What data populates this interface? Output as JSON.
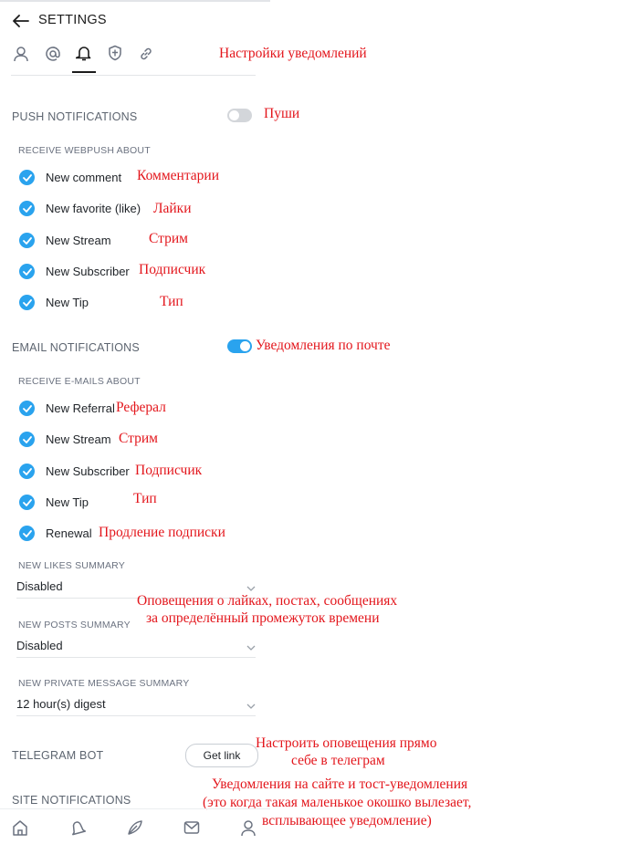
{
  "header": {
    "title": "SETTINGS"
  },
  "tabs": [
    "profile-tab",
    "mentions-tab",
    "notifications-tab",
    "security-tab",
    "links-tab"
  ],
  "push": {
    "title": "PUSH NOTIFICATIONS",
    "enabled": false,
    "subtitle": "RECEIVE WEBPUSH ABOUT",
    "items": [
      "New comment",
      "New favorite (like)",
      "New Stream",
      "New Subscriber",
      "New Tip"
    ]
  },
  "email": {
    "title": "EMAIL NOTIFICATIONS",
    "enabled": true,
    "subtitle": "RECEIVE E-MAILS ABOUT",
    "items": [
      "New Referral",
      "New Stream",
      "New Subscriber",
      "New Tip",
      "Renewal"
    ]
  },
  "summaries": [
    {
      "label": "NEW LIKES SUMMARY",
      "value": "Disabled"
    },
    {
      "label": "NEW POSTS SUMMARY",
      "value": "Disabled"
    },
    {
      "label": "NEW PRIVATE MESSAGE SUMMARY",
      "value": "12 hour(s) digest"
    }
  ],
  "telegram": {
    "title": "TELEGRAM BOT",
    "button": "Get link"
  },
  "site": {
    "title": "SITE NOTIFICATIONS"
  },
  "annotations": {
    "notifications_settings": "Настройки уведомлений",
    "push": "Пуши",
    "comments": "Комментарии",
    "likes": "Лайки",
    "stream": "Стрим",
    "subscriber": "Подписчик",
    "tip": "Тип",
    "email_notifications": "Уведомления по почте",
    "referral": "Реферал",
    "stream2": "Стрим",
    "subscriber2": "Подписчик",
    "tip2": "Тип",
    "renewal": "Продление подписки",
    "summaries_line1": "Оповещения о лайках, постах, сообщениях",
    "summaries_line2": "за определённый промежуток времени",
    "telegram_line1": "Настроить оповещения прямо",
    "telegram_line2": "себе в телеграм",
    "site_line1": "Уведомления на сайте и тост-уведомления",
    "site_line2": "(это когда такая маленькое окошко вылезает,",
    "site_line3": "всплывающее уведомление)"
  },
  "colors": {
    "accent": "#2aa3ee",
    "annotation": "#e3161c"
  },
  "bottom_nav": [
    "home-icon",
    "notifications-icon",
    "feed-icon",
    "messages-icon",
    "profile-icon"
  ]
}
